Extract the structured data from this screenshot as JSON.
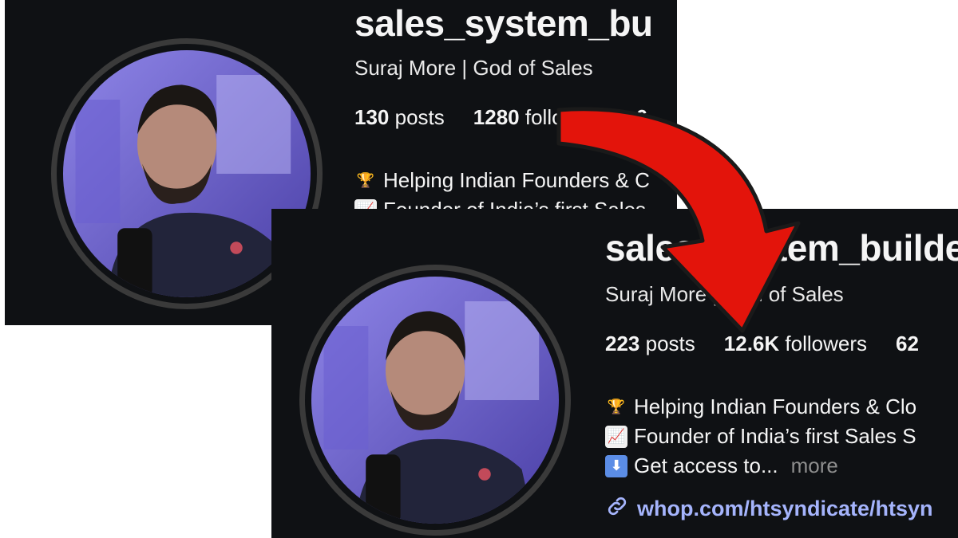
{
  "before": {
    "username": "sales_system_bu",
    "subtitle": "Suraj More | God of Sales",
    "posts_count": "130",
    "posts_label": "posts",
    "followers_count": "1280",
    "followers_label": "followers",
    "following_partial": "6",
    "bio": [
      {
        "icon": "trophy-icon",
        "text": "Helping Indian Founders & C"
      },
      {
        "icon": "chart-up-icon",
        "text": "Founder of India’s first Sales"
      }
    ]
  },
  "after": {
    "username": "sales_system_builde",
    "subtitle": "Suraj More | God of Sales",
    "posts_count": "223",
    "posts_label": "posts",
    "followers_count": "12.6K",
    "followers_label": "followers",
    "following_partial": "62",
    "bio": [
      {
        "icon": "trophy-icon",
        "text": "Helping Indian Founders & Clo"
      },
      {
        "icon": "chart-up-icon",
        "text": "Founder of India’s first Sales S"
      },
      {
        "icon": "down-arrow-icon",
        "text": "Get access to..."
      }
    ],
    "more_label": "more",
    "link_text": "whop.com/htsyndicate/htsyn"
  },
  "colors": {
    "background": "#0f1114",
    "arrow": "#e3140b",
    "link": "#a5b4fc"
  }
}
